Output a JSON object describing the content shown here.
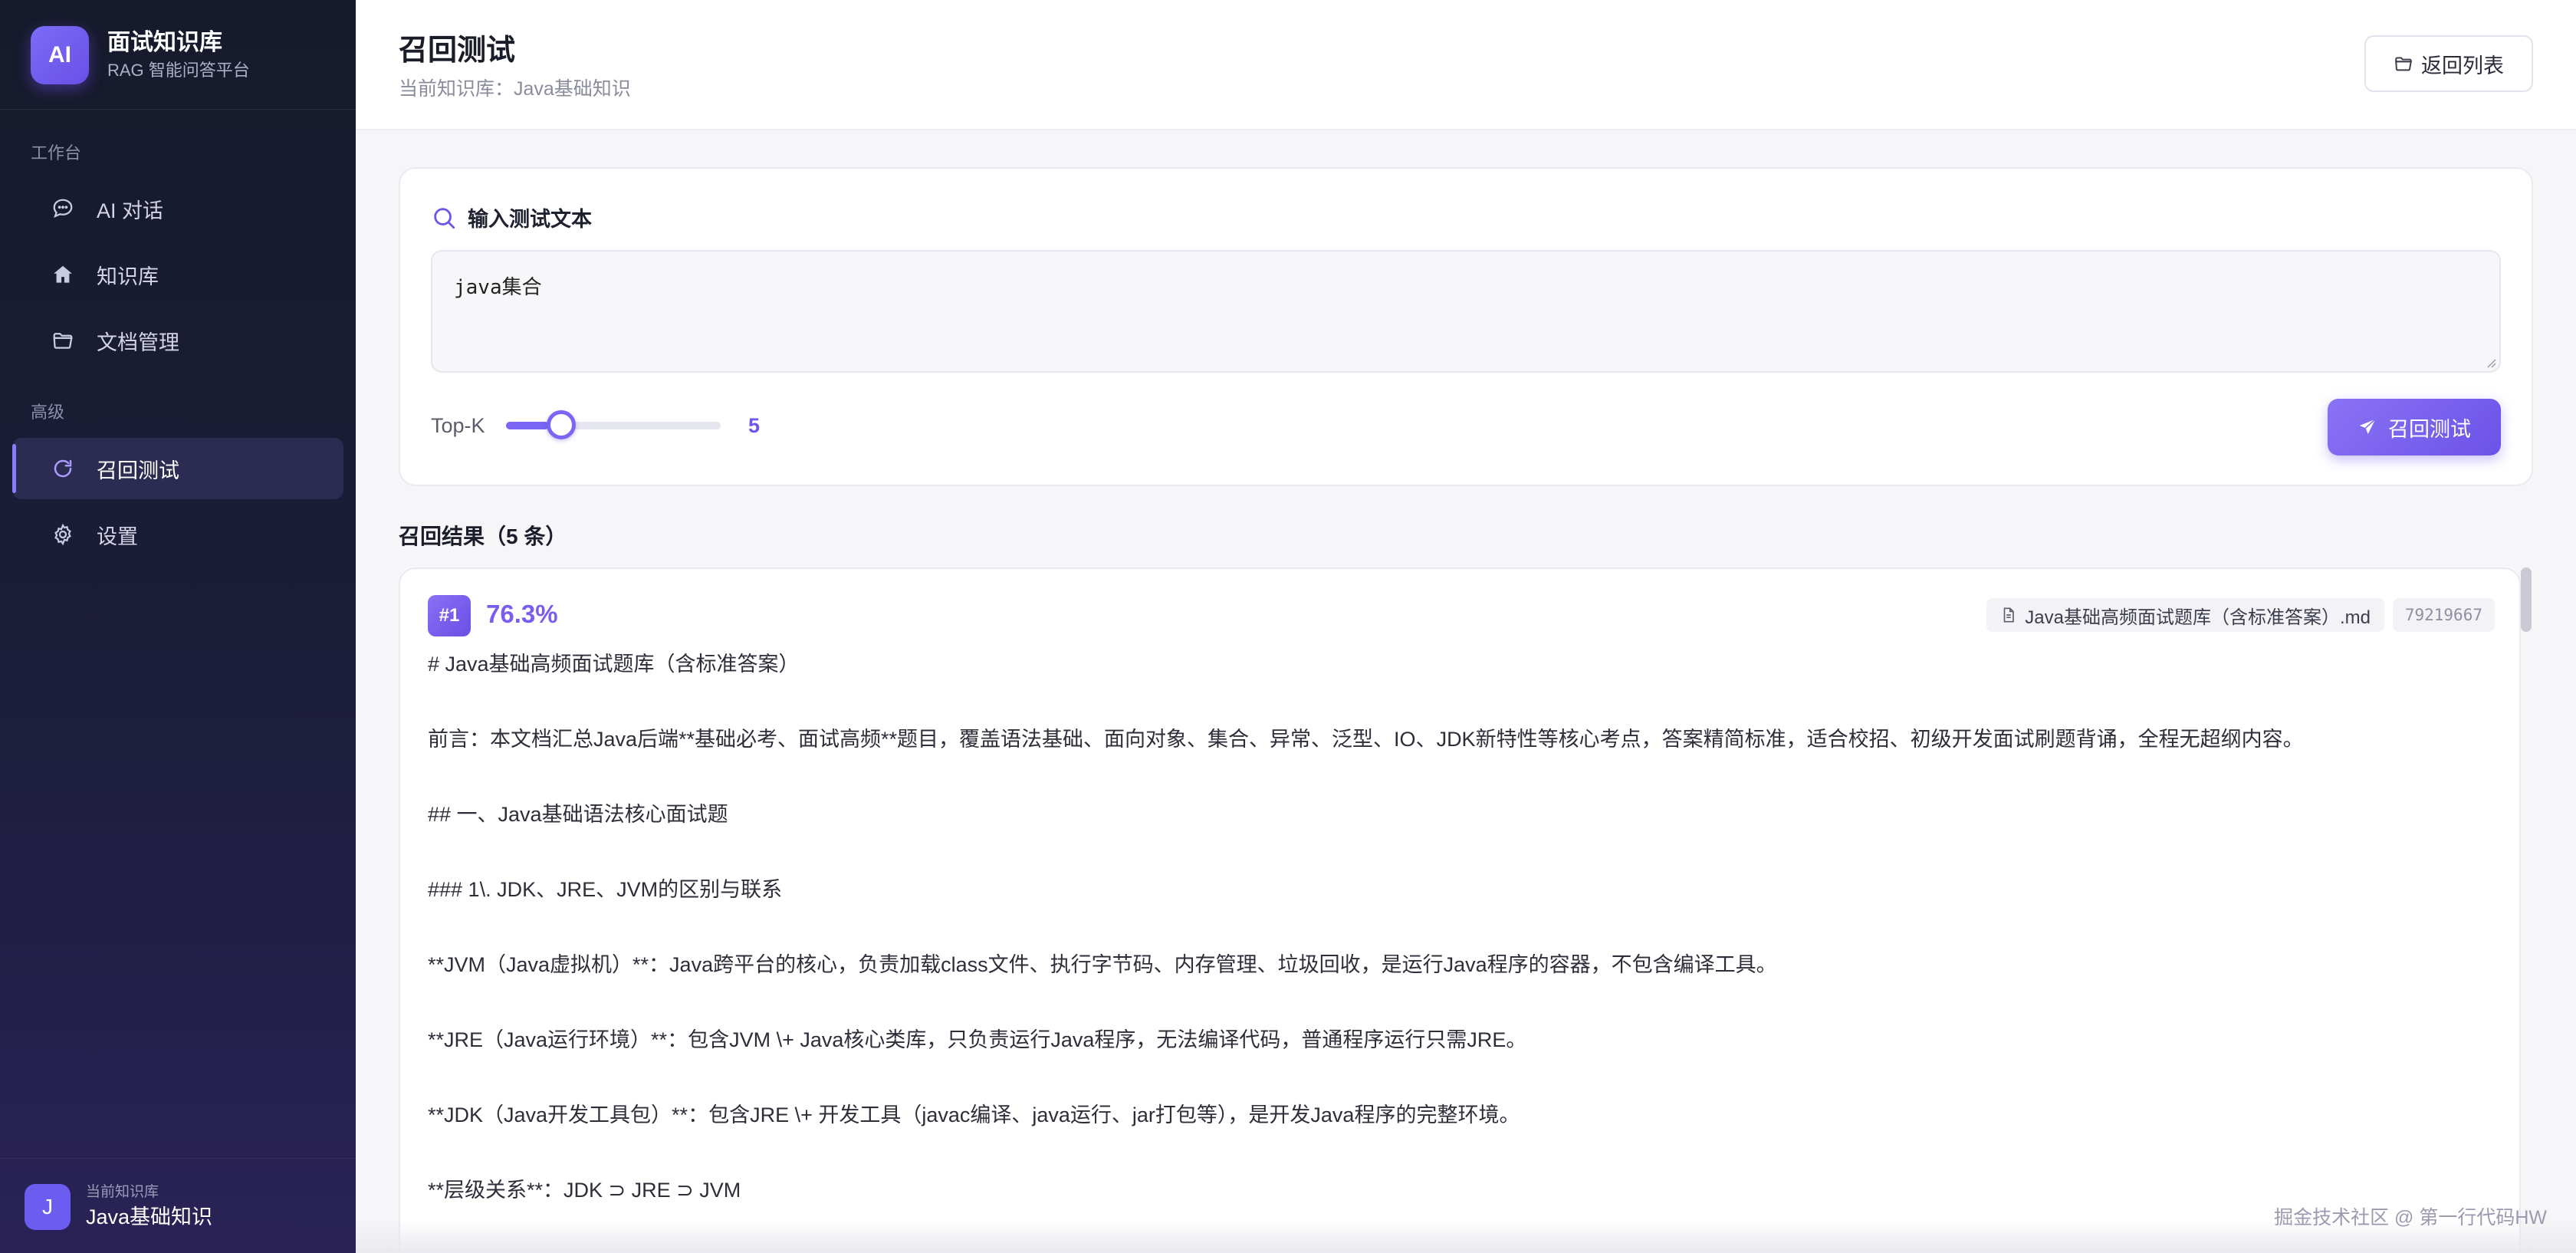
{
  "brand": {
    "logo": "AI",
    "title": "面试知识库",
    "subtitle": "RAG 智能问答平台"
  },
  "sidebar": {
    "section_workbench": "工作台",
    "section_advanced": "高级",
    "items": [
      {
        "label": "AI 对话",
        "icon": "chat-icon"
      },
      {
        "label": "知识库",
        "icon": "home-icon"
      },
      {
        "label": "文档管理",
        "icon": "folder-icon"
      },
      {
        "label": "召回测试",
        "icon": "refresh-icon",
        "active": true
      },
      {
        "label": "设置",
        "icon": "gear-icon"
      }
    ],
    "current_kb": {
      "avatar": "J",
      "label": "当前知识库",
      "name": "Java基础知识"
    }
  },
  "header": {
    "title": "召回测试",
    "subtitle": "当前知识库：Java基础知识",
    "back_label": "返回列表"
  },
  "query": {
    "heading": "输入测试文本",
    "text": "java集合",
    "topk_label": "Top-K",
    "topk_value": "5",
    "topk_fraction": 0.2,
    "run_label": "召回测试"
  },
  "results": {
    "title": "召回结果（5 条）",
    "items": [
      {
        "rank": "#1",
        "score": "76.3%",
        "file": "Java基础高频面试题库（含标准答案）.md",
        "id": "79219667",
        "lines": [
          "# Java基础高频面试题库（含标准答案）",
          "前言：本文档汇总Java后端**基础必考、面试高频**题目，覆盖语法基础、面向对象、集合、异常、泛型、IO、JDK新特性等核心考点，答案精简标准，适合校招、初级开发面试刷题背诵，全程无超纲内容。",
          "## 一、Java基础语法核心面试题",
          "### 1\\. JDK、JRE、JVM的区别与联系",
          "**JVM（Java虚拟机）**：Java跨平台的核心，负责加载class文件、执行字节码、内存管理、垃圾回收，是运行Java程序的容器，不包含编译工具。",
          "**JRE（Java运行环境）**：包含JVM \\+ Java核心类库，只负责运行Java程序，无法编译代码，普通程序运行只需JRE。",
          "**JDK（Java开发工具包）**：包含JRE \\+ 开发工具（javac编译、java运行、jar打包等），是开发Java程序的完整环境。",
          "**层级关系**：JDK ⊃ JRE ⊃ JVM"
        ]
      }
    ]
  },
  "watermark": "掘金技术社区 @ 第一行代码HW",
  "colors": {
    "accent": "#6d56e8",
    "sidebar_bg": "#1a1c33",
    "active_bg": "#2c2b52"
  }
}
